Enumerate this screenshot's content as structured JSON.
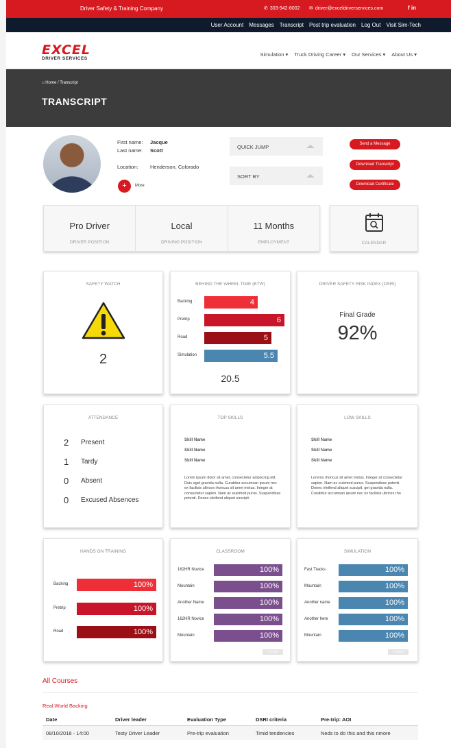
{
  "topbar": {
    "brand": "Driver Safety & Training Company",
    "phone": "303-942-8002",
    "email": "driver@exceldriverservices.com",
    "social": "f in"
  },
  "account_nav": [
    "User Account",
    "Messages",
    "Transcript",
    "Post trip evaluation",
    "Log Out",
    "Visit Sim-Tech"
  ],
  "logo": {
    "line1": "EXCEL",
    "line2": "DRIVER SERVICES"
  },
  "main_nav": [
    "Simulation ▾",
    "Truck Driving Career ▾",
    "Our Services ▾",
    "About Us ▾"
  ],
  "hero": {
    "breadcrumb": "Home / Transcript",
    "title": "TRANSCRIPT"
  },
  "profile": {
    "first_name_label": "First name:",
    "first_name": "Jacque",
    "last_name_label": "Last name:",
    "last_name": "Scott",
    "location_label": "Location:",
    "location": "Henderson, Colorado",
    "more": "More"
  },
  "selects": {
    "quick_jump": "QUICK JUMP",
    "sort_by": "SORT BY"
  },
  "actions": {
    "send_message": "Send a Message",
    "download_transcript": "Download Transcript",
    "download_certificate": "Download  Certificate"
  },
  "stats": [
    {
      "value": "Pro Driver",
      "label": "DRIVER POSITION"
    },
    {
      "value": "Local",
      "label": "DRIVING POSITION"
    },
    {
      "value": "11 Months",
      "label": "EMPLOYMENT"
    }
  ],
  "calendar": {
    "label": "CALENDAR"
  },
  "safety_watch": {
    "title": "SAFETY WATCH",
    "value": "2"
  },
  "btw": {
    "title": "BEHIND THE WHEEL TIME (BTW)",
    "bars": [
      {
        "label": "Backing",
        "value": "4",
        "color": "#ef2f38"
      },
      {
        "label": "Pretrip",
        "value": "6",
        "color": "#c8152a"
      },
      {
        "label": "Road",
        "value": "5",
        "color": "#9b0f16"
      },
      {
        "label": "Simulation",
        "value": "5.5",
        "color": "#4a86b0"
      }
    ],
    "total": "20.5"
  },
  "dsri": {
    "title": "DRIVER SAFETY RISK INDEX (DSRI)",
    "label": "Final Grade",
    "value": "92%"
  },
  "attendance": {
    "title": "ATTENDANCE",
    "rows": [
      {
        "n": "2",
        "label": "Present"
      },
      {
        "n": "1",
        "label": "Tardy"
      },
      {
        "n": "0",
        "label": "Absent"
      },
      {
        "n": "0",
        "label": "Excused Absences"
      }
    ]
  },
  "top_skills": {
    "title": "TOP SKILLS",
    "skills": [
      "Skill Name",
      "Skill Name",
      "Skill Name"
    ],
    "text": "Lorem ipsum dolor sit amet, consectetur adipiscing elit. Duis eget gravida nulla. Curabitur accumsan ipsum nec ex facilisis ultrices rhoncus sit amet metus. Integer at consectetur sapien. Nam ac euismod purus. Suspendisse potenti. Donec eleifend aliquet suscipit."
  },
  "low_skills": {
    "title": "LOW SKILLS",
    "skills": [
      "Skill Name",
      "Skill Name",
      "Skill Name"
    ],
    "text": "Lorems rhoncus sit amet metus. Integer at consectetur sapien. Nam ac euismod purus. Suspendisse potenti. Donec eleifend aliquet suscipit. get gravida nulla. Curabitur accumsan ipsum nec ex facilisis ultrices rho"
  },
  "hands_on": {
    "title": "HANDS ON TRAINING",
    "bars": [
      {
        "label": "Backing",
        "value": "100%",
        "color": "#ef2f38"
      },
      {
        "label": "Pretrip",
        "value": "100%",
        "color": "#c8152a"
      },
      {
        "label": "Road",
        "value": "100%",
        "color": "#9b0f16"
      }
    ]
  },
  "classroom": {
    "title": "CLASSROOM",
    "bars": [
      {
        "label": "162HR Novice",
        "value": "100%"
      },
      {
        "label": "Mountain",
        "value": "100%"
      },
      {
        "label": "Another Name",
        "value": "100%"
      },
      {
        "label": "162HR Novice",
        "value": "100%"
      },
      {
        "label": "Mountain",
        "value": "100%"
      }
    ],
    "color": "#7b4f8e",
    "more": "+ more"
  },
  "simulation": {
    "title": "SIMULATION",
    "bars": [
      {
        "label": "Fast Tracks",
        "value": "100%"
      },
      {
        "label": "Mountain",
        "value": "100%"
      },
      {
        "label": "Another name",
        "value": "100%"
      },
      {
        "label": "Another here",
        "value": "100%"
      },
      {
        "label": "Mountain",
        "value": "100%"
      }
    ],
    "color": "#4a86b0",
    "more": "+ more"
  },
  "courses": {
    "title": "All Courses",
    "section": "Real World Backing",
    "headers": [
      "Date",
      "Driver leader",
      "Evaluation Type",
      "DSRI criteria",
      "Pre-trip: AOI"
    ],
    "row": [
      "08/10/2018 - 14:00",
      "Testy Driver Leader",
      "Pre-trip evaluation",
      "Timid tendencies",
      "Neds to do this and this nmore"
    ]
  }
}
